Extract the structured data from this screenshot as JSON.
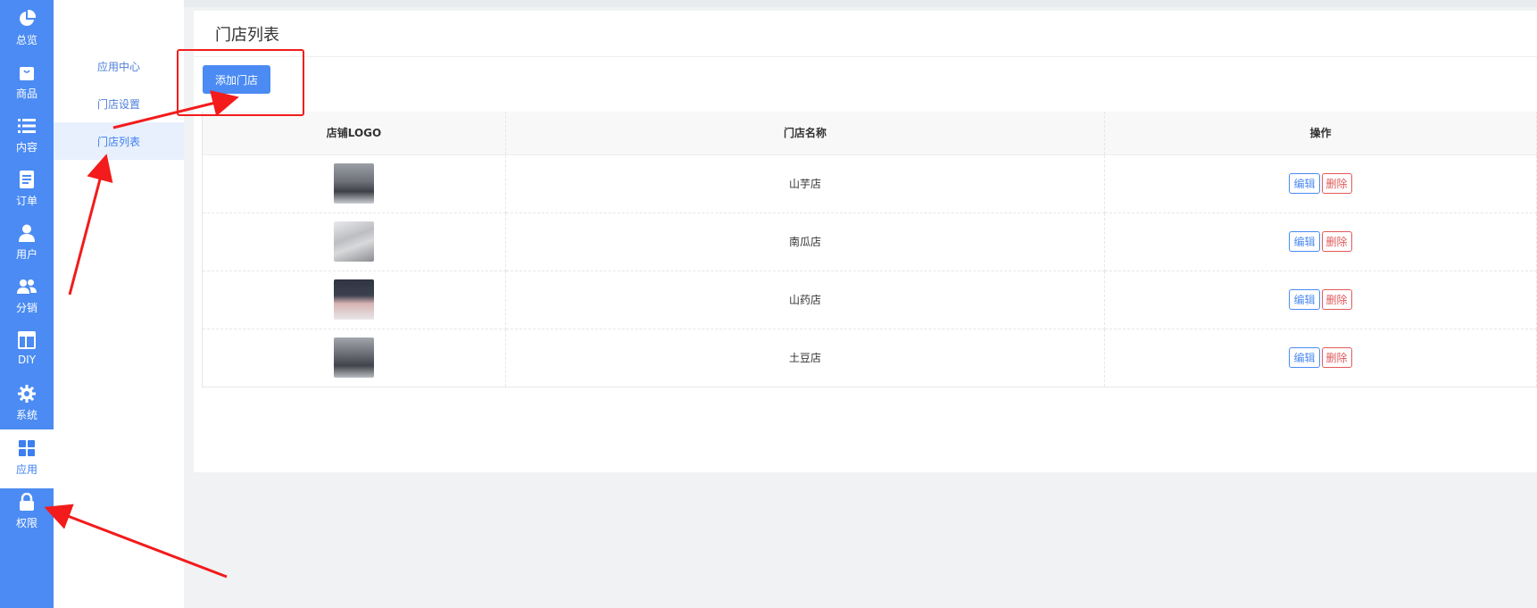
{
  "nav": {
    "items": [
      {
        "label": "总览",
        "icon": "pie-chart-icon"
      },
      {
        "label": "商品",
        "icon": "shopping-bag-icon"
      },
      {
        "label": "内容",
        "icon": "list-icon"
      },
      {
        "label": "订单",
        "icon": "document-icon"
      },
      {
        "label": "用户",
        "icon": "user-icon"
      },
      {
        "label": "分销",
        "icon": "users-icon"
      },
      {
        "label": "DIY",
        "icon": "layout-icon"
      },
      {
        "label": "系统",
        "icon": "gear-icon"
      },
      {
        "label": "应用",
        "icon": "apps-grid-icon",
        "active": true
      },
      {
        "label": "权限",
        "icon": "lock-icon"
      }
    ]
  },
  "submenu": {
    "items": [
      {
        "label": "应用中心"
      },
      {
        "label": "门店设置"
      },
      {
        "label": "门店列表",
        "active": true
      }
    ]
  },
  "main": {
    "title": "门店列表",
    "add_button": "添加门店",
    "table": {
      "headers": [
        "店铺LOGO",
        "门店名称",
        "操作"
      ],
      "rows": [
        {
          "name": "山芋店",
          "edit": "编辑",
          "delete": "删除"
        },
        {
          "name": "南瓜店",
          "edit": "编辑",
          "delete": "删除"
        },
        {
          "name": "山药店",
          "edit": "编辑",
          "delete": "删除"
        },
        {
          "name": "土豆店",
          "edit": "编辑",
          "delete": "删除"
        }
      ]
    }
  },
  "colors": {
    "accent": "#4b8bf3",
    "danger": "#e05a5a",
    "annotation": "#f31b1b"
  }
}
